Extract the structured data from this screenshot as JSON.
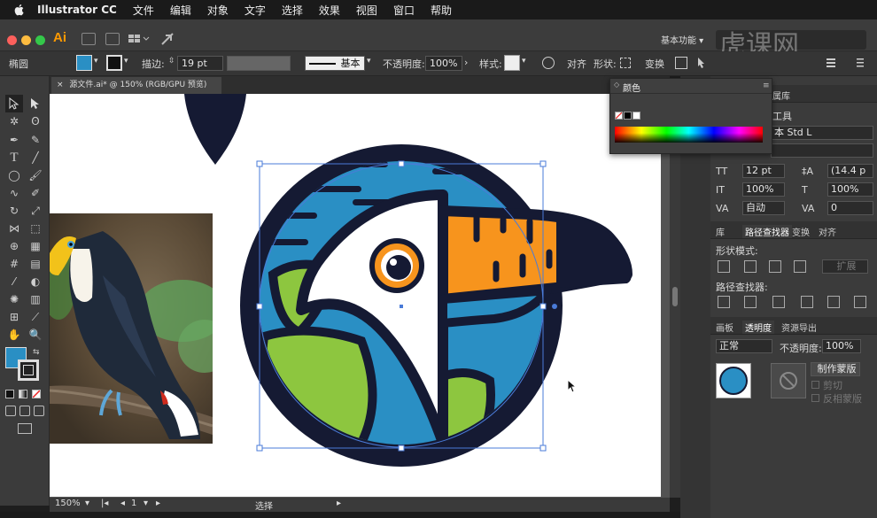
{
  "menubar": {
    "items": [
      "Illustrator CC",
      "文件",
      "编辑",
      "对象",
      "文字",
      "选择",
      "效果",
      "视图",
      "窗口",
      "帮助"
    ]
  },
  "appbar": {
    "logo": "Ai",
    "workspace": "基本功能",
    "watermark": "虎课网"
  },
  "control": {
    "object_type": "椭圆",
    "stroke_label": "描边:",
    "stroke_value": "19 pt",
    "brush_label": "基本",
    "opacity_label": "不透明度:",
    "opacity_value": "100%",
    "style_label": "样式:",
    "align_label": "对齐",
    "shape_label": "形状:",
    "transform_label": "变换",
    "fill_color": "#2a8fc4"
  },
  "document": {
    "tab_title": "源文件.ai* @ 150% (RGB/GPU 预览)"
  },
  "status": {
    "zoom": "150%",
    "artboard_num": "1",
    "tool_status": "选择"
  },
  "color_panel": {
    "title": "颜色"
  },
  "right_panel": {
    "top_tab": "属库",
    "tools_label": "工具",
    "font_name": "本 Std L",
    "font_size": "12 pt",
    "leading": "(14.4 p",
    "h_scale": "100%",
    "v_scale": "100%",
    "kerning": "自动",
    "tracking": "0",
    "tabs1": [
      "库",
      "路径查找器",
      "变换",
      "对齐"
    ],
    "shape_mode_label": "形状模式:",
    "expand_label": "扩展",
    "pathfinder_label": "路径查找器:",
    "tabs2": [
      "画板",
      "透明度",
      "资源导出"
    ],
    "blend_mode": "正常",
    "opacity_label": "不透明度:",
    "opacity_value": "100%",
    "make_mask": "制作蒙版",
    "clip": "剪切",
    "invert_mask": "反相蒙版"
  },
  "colors": {
    "navy": "#151a33",
    "blue": "#2a8fc4",
    "orange": "#f7941d",
    "green": "#8dc63f",
    "white": "#ffffff",
    "selection": "#4a7bd8"
  }
}
